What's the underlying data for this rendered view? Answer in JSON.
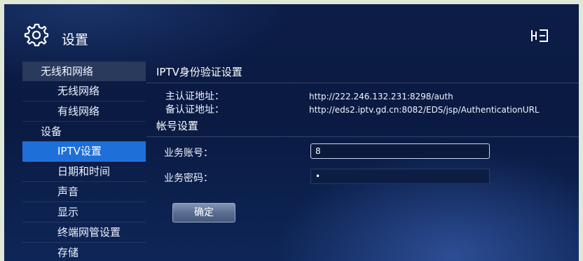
{
  "header": {
    "title": "设置",
    "icon": "gear-icon",
    "corner_icon": "network-exit-icon"
  },
  "sidebar": {
    "groups": [
      {
        "label": "无线和网络",
        "items": [
          "无线网络",
          "有线网络"
        ]
      },
      {
        "label": "设备",
        "items": [
          "IPTV设置",
          "日期和时间",
          "声音",
          "显示",
          "终端网管设置",
          "存储"
        ]
      }
    ],
    "active_item": "IPTV设置"
  },
  "content": {
    "auth_section": {
      "title": "IPTV身份验证设置",
      "primary_label": "主认证地址：",
      "primary_value": "http://222.246.132.231:8298/auth",
      "backup_label": "备认证地址：",
      "backup_value": "http://eds2.iptv.gd.cn:8082/EDS/jsp/AuthenticationURL"
    },
    "account_section": {
      "title": "帐号设置",
      "account_label": "业务账号：",
      "account_value": "8",
      "password_label": "业务密码：",
      "password_value": "•"
    },
    "confirm_button": "确定"
  },
  "colors": {
    "active": "#1f6fd8",
    "background": "#0b1a42"
  }
}
